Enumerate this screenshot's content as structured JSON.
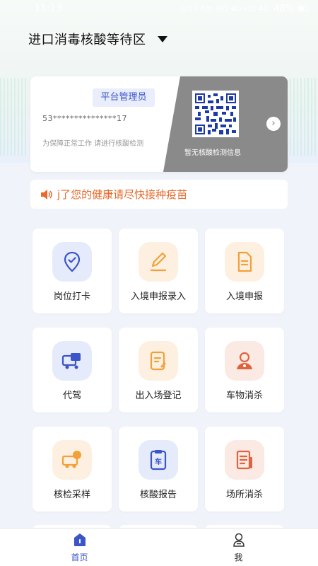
{
  "status_bar": {
    "time": "11:13",
    "net_speed": "0.07 K/s",
    "indicators": "HD 4G HD 4G",
    "battery": "48%"
  },
  "header": {
    "title": "进口消毒核酸等待区"
  },
  "profile_card": {
    "role": "平台管理员",
    "id_masked": "53***************17",
    "tip": "为保障正常工作 请进行核酸检测",
    "qr_caption": "暂无核酸检测信息"
  },
  "notice": {
    "text": "j了您的健康请尽快接种疫苗"
  },
  "tiles": [
    {
      "label": "岗位打卡",
      "icon": "location-check-icon",
      "theme": "blue"
    },
    {
      "label": "入境申报录入",
      "icon": "edit-pen-icon",
      "theme": "orange"
    },
    {
      "label": "入境申报",
      "icon": "document-icon",
      "theme": "orange"
    },
    {
      "label": "代驾",
      "icon": "truck-icon",
      "theme": "blue"
    },
    {
      "label": "出入场登记",
      "icon": "register-form-icon",
      "theme": "orange"
    },
    {
      "label": "车物消杀",
      "icon": "person-icon",
      "theme": "red"
    },
    {
      "label": "核检采样",
      "icon": "sample-truck-icon",
      "theme": "orange"
    },
    {
      "label": "核酸报告",
      "icon": "car-report-icon",
      "theme": "blue"
    },
    {
      "label": "场所消杀",
      "icon": "site-document-icon",
      "theme": "red"
    }
  ],
  "bottom_nav": {
    "home_label": "首页",
    "me_label": "我"
  },
  "colors": {
    "accent": "#3b54c8",
    "notice": "#e8692a",
    "orange_icon": "#f2a03a",
    "red_icon": "#e0633d"
  }
}
